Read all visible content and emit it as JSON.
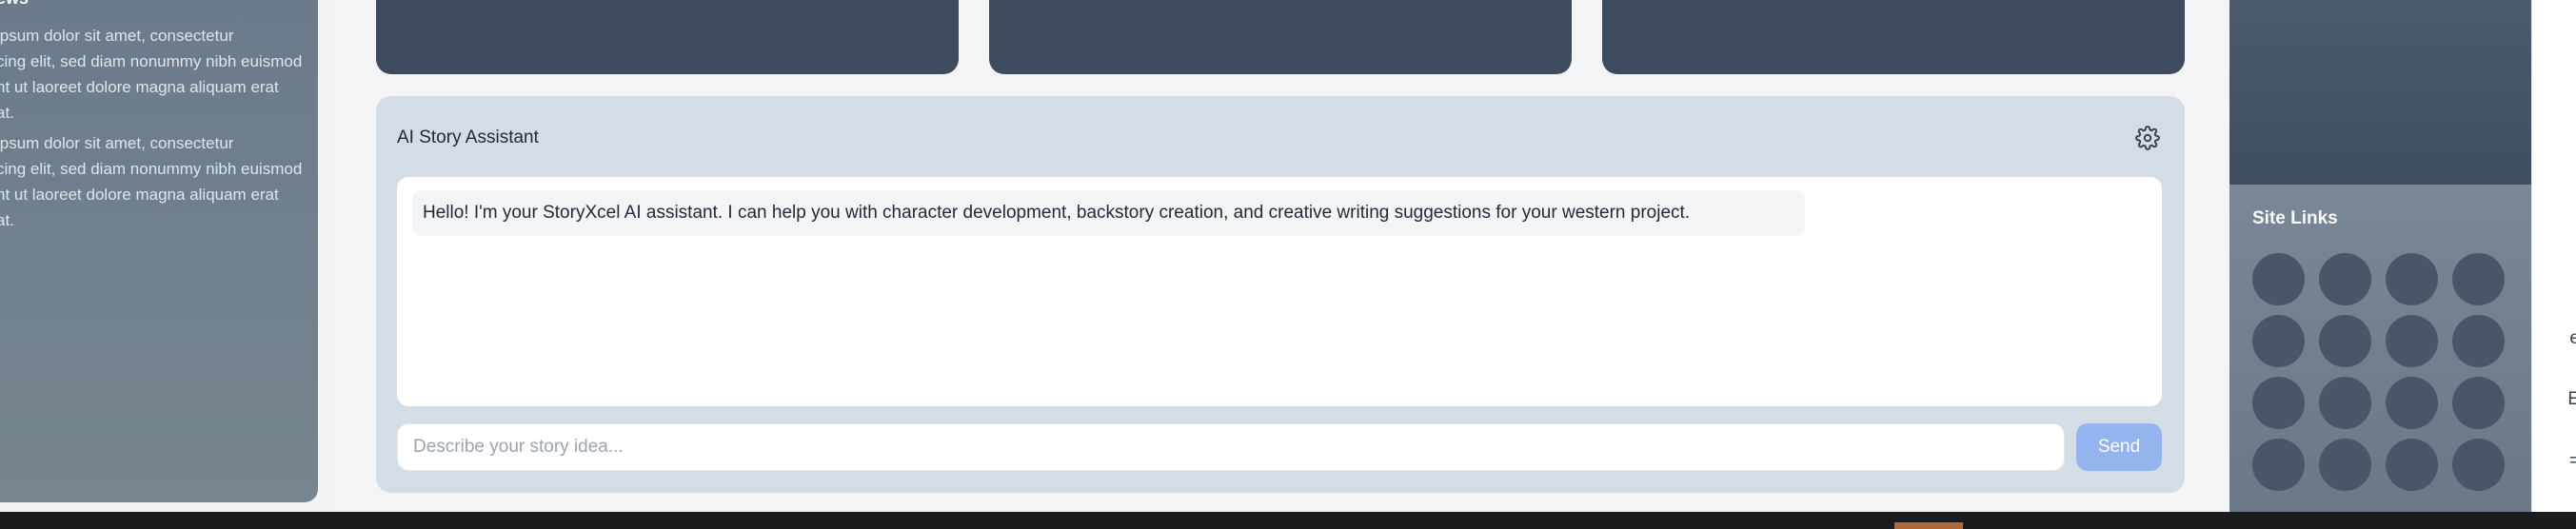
{
  "left_panel": {
    "title": "ews",
    "paragraphs": [
      "ipsum dolor sit amet, consectetur\ncing elit, sed diam nonummy nibh euismod\nnt ut laoreet dolore magna aliquam erat\nat.",
      "ipsum dolor sit amet, consectetur\ncing elit, sed diam nonummy nibh euismod\nnt ut laoreet dolore magna aliquam erat\nat."
    ]
  },
  "assistant": {
    "title": "AI Story Assistant",
    "settings_icon": "gear-icon",
    "message": "Hello! I'm your StoryXcel AI assistant. I can help you with character development, backstory creation, and creative writing suggestions for your western project.",
    "input_placeholder": "Describe your story idea...",
    "input_value": "",
    "send_label": "Send"
  },
  "site_links": {
    "title": "Site Links",
    "items_count": 16
  },
  "right_edge": {
    "chars": [
      "e",
      "E",
      "="
    ]
  },
  "colors": {
    "card_dark": "#3e4b5f",
    "assistant_bg": "#d4dde5",
    "send_button": "#93b4ef",
    "link_dot": "#4a5668",
    "taskbar_accent": "#b0683a"
  }
}
